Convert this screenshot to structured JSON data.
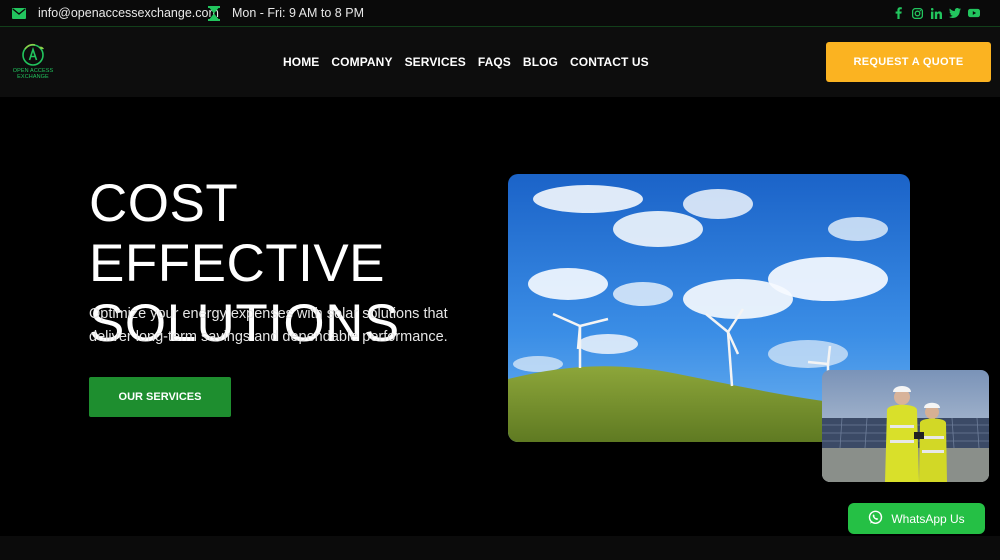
{
  "topbar": {
    "email": "info@openaccessexchange.com",
    "hours": "Mon - Fri: 9 AM to 8 PM",
    "icons": [
      "envelope-icon",
      "hourglass-icon"
    ],
    "social": [
      "facebook-icon",
      "instagram-icon",
      "linkedin-icon",
      "twitter-icon",
      "youtube-icon"
    ]
  },
  "brand": {
    "logo_line1": "OPEN ACCESS",
    "logo_line2": "EXCHANGE",
    "accent": "#22c55e"
  },
  "nav": {
    "items": [
      "HOME",
      "COMPANY",
      "SERVICES",
      "FAQS",
      "BLOG",
      "CONTACT US"
    ]
  },
  "header": {
    "quote_button": "REQUEST A QUOTE",
    "quote_color": "#fbb321"
  },
  "hero": {
    "title_line1": "COST EFFECTIVE",
    "title_line2": "SOLUTIONS",
    "description": "Optimize your energy expenses with solar solutions that deliver long-term savings and dependable performance.",
    "cta_label": "OUR SERVICES",
    "cta_color": "#1e8e2f"
  },
  "whatsapp": {
    "label": "WhatsApp Us",
    "color": "#25c045"
  }
}
